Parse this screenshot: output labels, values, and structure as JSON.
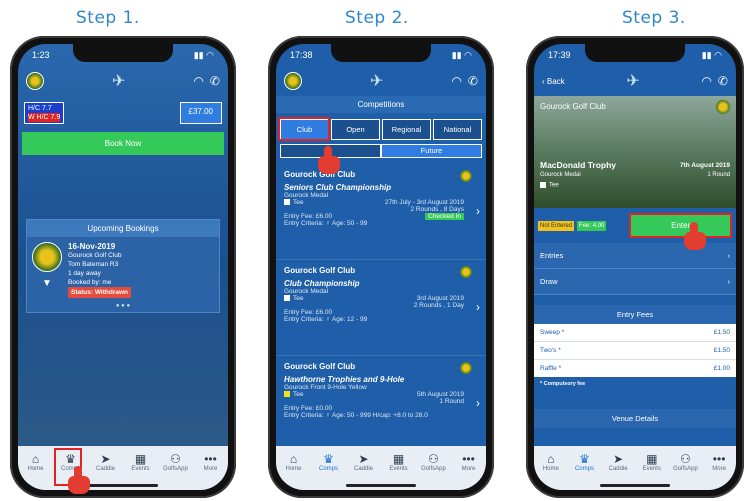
{
  "steps": [
    "Step 1.",
    "Step 2.",
    "Step 3."
  ],
  "colors": {
    "accent": "#2f86c9",
    "green": "#2ecc55",
    "red": "#e02424",
    "blue": "#1f5ea8"
  },
  "tabs": [
    {
      "icon": "home-icon",
      "glyph": "⌂",
      "label": "Home"
    },
    {
      "icon": "comps-icon",
      "glyph": "♛",
      "label": "Comps"
    },
    {
      "icon": "caddie-icon",
      "glyph": "➤",
      "label": "Caddie"
    },
    {
      "icon": "events-icon",
      "glyph": "▦",
      "label": "Events"
    },
    {
      "icon": "golfsapp-icon",
      "glyph": "⚇",
      "label": "GolfsApp"
    },
    {
      "icon": "more-icon",
      "glyph": "•••",
      "label": "More"
    }
  ],
  "phone1": {
    "time": "1:23",
    "hc": "H/C 7.7",
    "whc": "W H/C 7.9",
    "balance": "£37.00",
    "book_now": "Book Now",
    "upcoming_title": "Upcoming Bookings",
    "booking": {
      "date": "16-Nov-2019",
      "club": "Gourock Golf Club",
      "player": "Tom Bateman R3",
      "away": "1 day away",
      "booked_by": "Booked by: me",
      "status": "Status: Withdrawn"
    }
  },
  "phone2": {
    "time": "17:38",
    "title": "Competitions",
    "filters": [
      "Club",
      "Open",
      "Regional",
      "National"
    ],
    "future": "Future",
    "comps": [
      {
        "club": "Gourock Golf Club",
        "name": "Seniors Club Championship",
        "course": "Gourock Medal",
        "tee": "Tee",
        "dates": "27th July - 3rd August 2019",
        "rounds": "2 Rounds , 8 Days",
        "fee": "Entry Fee: £6.00",
        "status": "Checked In",
        "criteria": "Entry Criteria:",
        "age": "Age: 50 - 99"
      },
      {
        "club": "Gourock Golf Club",
        "name": "Club Championship",
        "course": "Gourock Medal",
        "tee": "Tee",
        "dates": "3rd August 2019",
        "rounds": "2 Rounds , 1 Day",
        "fee": "Entry Fee: £6.00",
        "status": "",
        "criteria": "Entry Criteria:",
        "age": "Age: 12 - 99"
      },
      {
        "club": "Gourock Golf Club",
        "name": "Hawthorne Trophies and 9-Hole",
        "course": "Gourock Front 9-Hole Yellow",
        "tee": "Tee",
        "dates": "5th August 2019",
        "rounds": "1 Round",
        "fee": "Entry Fee: £0.00",
        "status": "",
        "criteria": "Entry Criteria:",
        "age": "Age: 50 - 999 H/cap: +8.0 to 28.0"
      }
    ]
  },
  "phone3": {
    "time": "17:39",
    "back": "Back",
    "club": "Gourock Golf Club",
    "comp_name": "MacDonald Trophy",
    "course": "Gourock Medal",
    "date": "7th August 2019",
    "rounds": "1 Round",
    "tee": "Tee",
    "not_entered": "Not Entered",
    "fee": "Fee: 4.00",
    "enter": "Enter",
    "entries": "Entries",
    "draw": "Draw",
    "entry_fees_title": "Entry Fees",
    "fees": [
      {
        "name": "Sweep *",
        "amount": "£1.50"
      },
      {
        "name": "Two's *",
        "amount": "£1.50"
      },
      {
        "name": "Raffle *",
        "amount": "£1.00"
      }
    ],
    "compulsory": "* Compulsory fee",
    "venue": "Venue Details"
  }
}
